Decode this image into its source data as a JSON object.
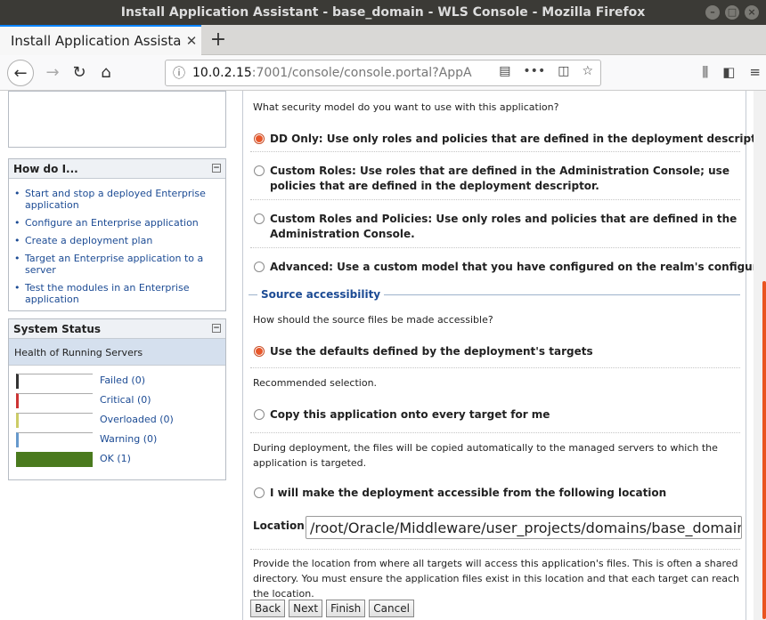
{
  "window": {
    "title": "Install Application Assistant - base_domain - WLS Console - Mozilla Firefox"
  },
  "browser": {
    "tab_title": "Install Application Assistant",
    "url_host": "10.0.2.15",
    "url_rest": ":7001/console/console.portal?AppA"
  },
  "sidebar": {
    "howdo": {
      "title": "How do I...",
      "items": [
        "Start and stop a deployed Enterprise application",
        "Configure an Enterprise application",
        "Create a deployment plan",
        "Target an Enterprise application to a server",
        "Test the modules in an Enterprise application"
      ]
    },
    "status": {
      "title": "System Status",
      "health_label": "Health of Running Servers",
      "rows": [
        {
          "label": "Failed (0)",
          "color": "#333333"
        },
        {
          "label": "Critical (0)",
          "color": "#cc3333"
        },
        {
          "label": "Overloaded (0)",
          "color": "#cccc66"
        },
        {
          "label": "Warning (0)",
          "color": "#6699cc"
        },
        {
          "label": "OK (1)",
          "color": "#4a7a1e"
        }
      ]
    }
  },
  "main": {
    "security_question": "What security model do you want to use with this application?",
    "security_options": [
      {
        "label": "DD Only: Use only roles and policies that are defined in the deployment descriptors.",
        "checked": true
      },
      {
        "label": "Custom Roles: Use roles that are defined in the Administration Console; use policies that are defined in the deployment descriptor.",
        "checked": false
      },
      {
        "label": "Custom Roles and Policies: Use only roles and policies that are defined in the Administration Console.",
        "checked": false
      },
      {
        "label": "Advanced: Use a custom model that you have configured on the realm's configuration page.",
        "checked": false
      }
    ],
    "source_section_title": "Source accessibility",
    "source_question": "How should the source files be made accessible?",
    "source_options": [
      {
        "label": "Use the defaults defined by the deployment's targets",
        "checked": true,
        "note": "Recommended selection."
      },
      {
        "label": "Copy this application onto every target for me",
        "checked": false,
        "note": "During deployment, the files will be copied automatically to the managed servers to which the application is targeted."
      },
      {
        "label": "I will make the deployment accessible from the following location",
        "checked": false,
        "note": ""
      }
    ],
    "location_label": "Location:",
    "location_value": "/root/Oracle/Middleware/user_projects/domains/base_domain/servers",
    "location_note": "Provide the location from where all targets will access this application's files. This is often a shared directory. You must ensure the application files exist in this location and that each target can reach the location.",
    "buttons": {
      "back": "Back",
      "next": "Next",
      "finish": "Finish",
      "cancel": "Cancel"
    }
  }
}
